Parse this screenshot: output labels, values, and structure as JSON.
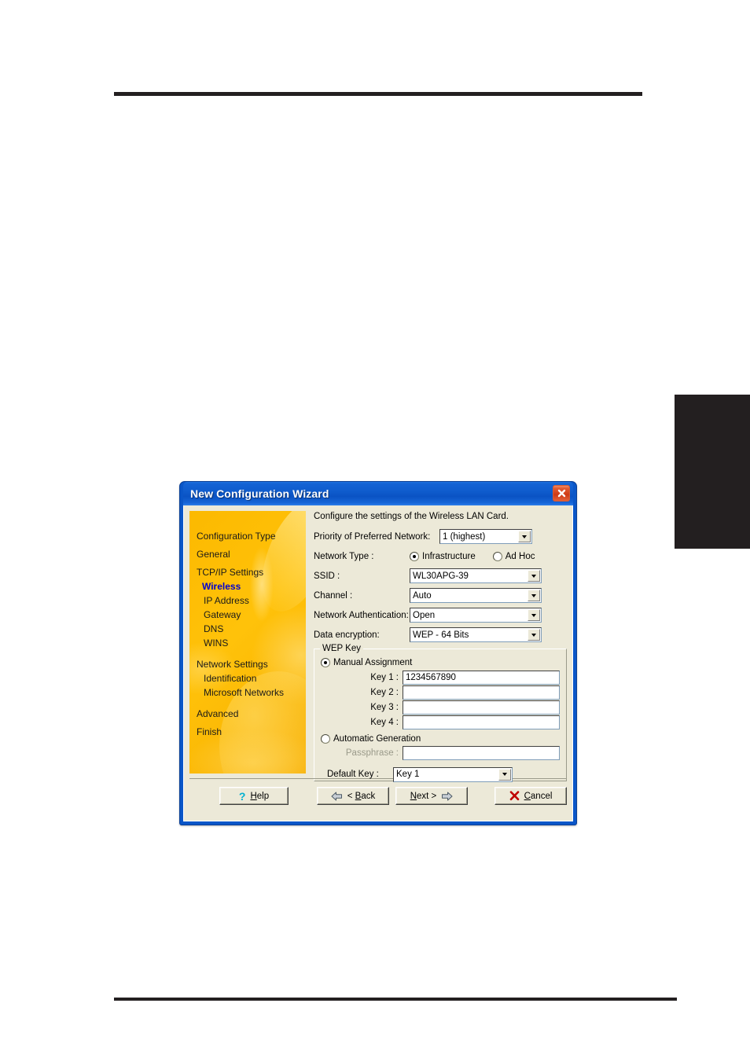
{
  "page": {
    "rule_top": "horizontal-rule",
    "rule_bottom": "horizontal-rule",
    "thumb_tab": "black-chapter-tab"
  },
  "dialog": {
    "title": "New Configuration Wizard",
    "close_icon": "close-icon",
    "intro": "Configure the settings of the Wireless LAN Card."
  },
  "sidebar": {
    "items": [
      {
        "label": "Configuration Type",
        "level": "top",
        "active": false
      },
      {
        "label": "General",
        "level": "top",
        "active": false
      },
      {
        "label": "TCP/IP Settings",
        "level": "top",
        "active": false
      },
      {
        "label": "Wireless",
        "level": "sub",
        "active": true
      },
      {
        "label": "IP Address",
        "level": "sub",
        "active": false
      },
      {
        "label": "Gateway",
        "level": "sub",
        "active": false
      },
      {
        "label": "DNS",
        "level": "sub",
        "active": false
      },
      {
        "label": "WINS",
        "level": "sub",
        "active": false
      },
      {
        "label": "Network Settings",
        "level": "top",
        "active": false
      },
      {
        "label": "Identification",
        "level": "sub",
        "active": false
      },
      {
        "label": "Microsoft Networks",
        "level": "sub",
        "active": false
      },
      {
        "label": "Advanced",
        "level": "top",
        "active": false
      },
      {
        "label": "Finish",
        "level": "top",
        "active": false
      }
    ],
    "active_color": "#0000d0",
    "panel_color": "#f8b400"
  },
  "form": {
    "priority_label": "Priority of Preferred Network:",
    "priority_value": "1 (highest)",
    "network_type_label": "Network Type :",
    "network_type_option_1": "Infrastructure",
    "network_type_option_2": "Ad Hoc",
    "network_type_selected": "Infrastructure",
    "ssid_label": "SSID :",
    "ssid_value": "WL30APG-39",
    "channel_label": "Channel :",
    "channel_value": "Auto",
    "auth_label": "Network Authentication:",
    "auth_value": "Open",
    "encryption_label": "Data encryption:",
    "encryption_value": "WEP - 64 Bits"
  },
  "wep": {
    "group_title": "WEP Key",
    "manual_label": "Manual Assignment",
    "manual_selected": true,
    "keys": [
      {
        "label": "Key 1 :",
        "value": "1234567890"
      },
      {
        "label": "Key 2 :",
        "value": ""
      },
      {
        "label": "Key 3 :",
        "value": ""
      },
      {
        "label": "Key 4 :",
        "value": ""
      }
    ],
    "auto_label": "Automatic Generation",
    "auto_selected": false,
    "passphrase_label": "Passphrase :",
    "passphrase_value": "",
    "default_key_label": "Default Key :",
    "default_key_value": "Key 1"
  },
  "footer": {
    "help_label": "Help",
    "help_icon": "question-mark-icon",
    "back_label": "< Back",
    "back_icon": "arrow-left-icon",
    "next_label": "Next >",
    "next_icon": "arrow-right-icon",
    "cancel_label": "Cancel",
    "cancel_icon": "red-x-icon"
  }
}
